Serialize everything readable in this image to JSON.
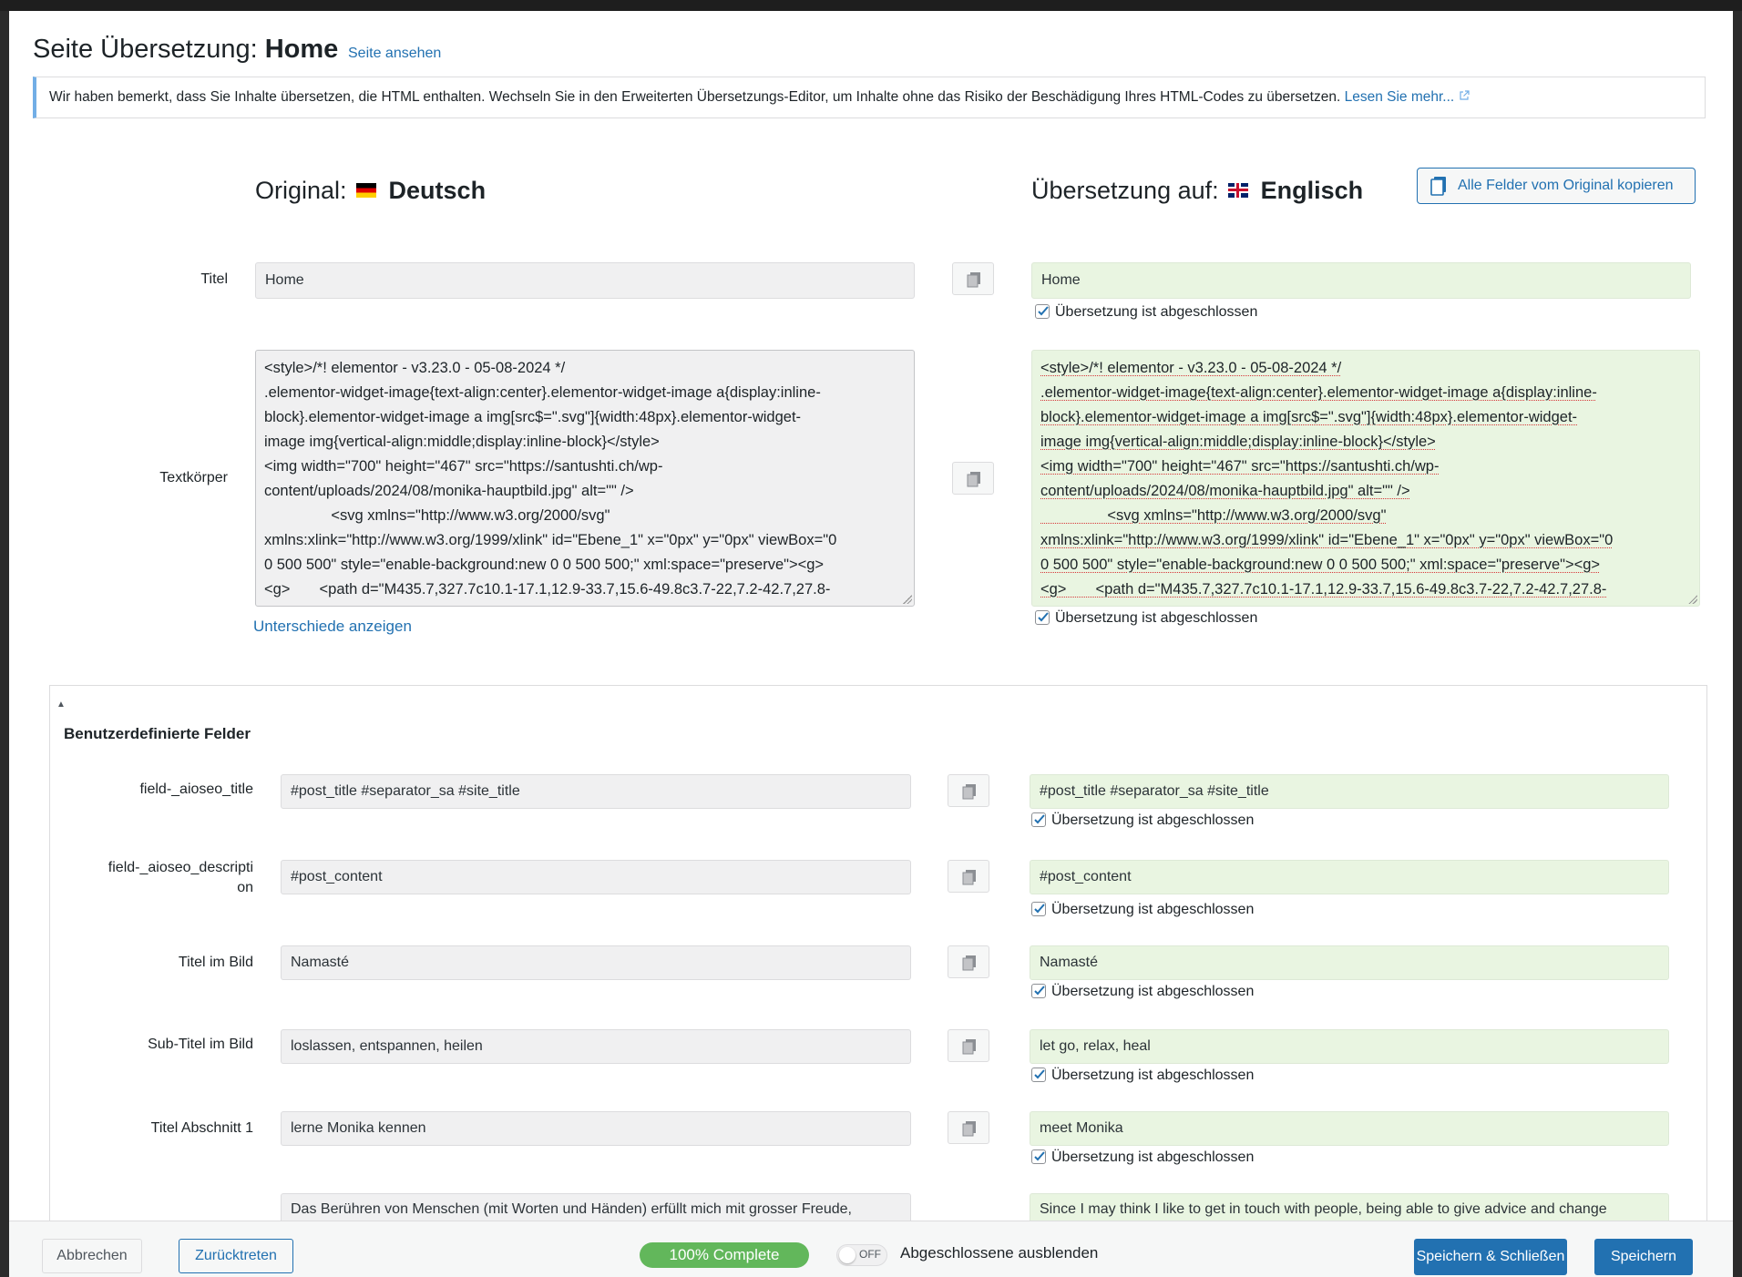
{
  "header": {
    "title_prefix": "Seite Übersetzung:",
    "title_page": "Home",
    "view_link": "Seite ansehen"
  },
  "notice": {
    "text": "Wir haben bemerkt, dass Sie Inhalte übersetzen, die HTML enthalten. Wechseln Sie in den Erweiterten Übersetzungs-Editor, um Inhalte ohne das Risiko der Beschädigung Ihres HTML-Codes zu übersetzen.",
    "link": "Lesen Sie mehr..."
  },
  "original": {
    "label": "Original:",
    "language": "Deutsch"
  },
  "translation": {
    "label": "Übersetzung auf:",
    "language": "Englisch"
  },
  "copy_all_label": "Alle Felder vom Original kopieren",
  "complete_label": "Übersetzung ist abgeschlossen",
  "title_field": {
    "label": "Titel",
    "original": "Home",
    "translation": "Home"
  },
  "body_field": {
    "label": "Textkörper",
    "original_lines": [
      "<style>/*! elementor - v3.23.0 - 05-08-2024 */",
      ".elementor-widget-image{text-align:center}.elementor-widget-image a{display:inline-",
      "block}.elementor-widget-image a img[src$=\".svg\"]{width:48px}.elementor-widget-",
      "image img{vertical-align:middle;display:inline-block}</style>",
      "<img width=\"700\" height=\"467\" src=\"https://santushti.ch/wp-",
      "content/uploads/2024/08/monika-hauptbild.jpg\" alt=\"\" />",
      "                <svg xmlns=\"http://www.w3.org/2000/svg\"",
      "xmlns:xlink=\"http://www.w3.org/1999/xlink\" id=\"Ebene_1\" x=\"0px\" y=\"0px\" viewBox=\"0",
      "0 500 500\" style=\"enable-background:new 0 0 500 500;\" xml:space=\"preserve\"><g>",
      "<g>       <path d=\"M435.7,327.7c10.1-17.1,12.9-33.7,15.6-49.8c3.7-22,7.2-42.7,27.8-"
    ],
    "translation_lines": [
      "<style>/*! elementor - v3.23.0 - 05-08-2024 */",
      ".elementor-widget-image{text-align:center}.elementor-widget-image a{display:inline-",
      "block}.elementor-widget-image a img[src$=\".svg\"]{width:48px}.elementor-widget-",
      "image img{vertical-align:middle;display:inline-block}</style>",
      "<img width=\"700\" height=\"467\" src=\"https://santushti.ch/wp-",
      "content/uploads/2024/08/monika-hauptbild.jpg\" alt=\"\" />",
      "                <svg xmlns=\"http://www.w3.org/2000/svg\"",
      "xmlns:xlink=\"http://www.w3.org/1999/xlink\" id=\"Ebene_1\" x=\"0px\" y=\"0px\" viewBox=\"0",
      "0 500 500\" style=\"enable-background:new 0 0 500 500;\" xml:space=\"preserve\"><g>",
      "<g>       <path d=\"M435.7,327.7c10.1-17.1,12.9-33.7,15.6-49.8c3.7-22,7.2-42.7,27.8-"
    ],
    "diff_link": "Unterschiede anzeigen"
  },
  "custom_fields": {
    "title": "Benutzerdefinierte Felder",
    "caret": "▲",
    "items": [
      {
        "label": "field-_aioseo_title",
        "original": "#post_title #separator_sa #site_title",
        "translation": "#post_title #separator_sa #site_title"
      },
      {
        "label_line1": "field-_aioseo_descripti",
        "label_line2": "on",
        "original": "#post_content",
        "translation": "#post_content"
      },
      {
        "label": "Titel im Bild",
        "original": "Namasté",
        "translation": "Namasté"
      },
      {
        "label": "Sub-Titel im Bild",
        "original": "loslassen, entspannen, heilen",
        "translation": "let go, relax, heal"
      },
      {
        "label": "Titel Abschnitt 1",
        "original": "lerne Monika kennen",
        "translation": "meet Monika"
      },
      {
        "original": "Das Berühren von Menschen (mit Worten und Händen) erfüllt mich mit grosser Freude,",
        "translation": "Since I may think I like to get in touch with people, being able to give advice and change"
      }
    ]
  },
  "footer": {
    "cancel": "Abbrechen",
    "back": "Zurücktreten",
    "progress": "100% Complete",
    "progress_percent": 100,
    "toggle_state": "OFF",
    "hide_completed": "Abgeschlossene ausblenden",
    "save_close": "Speichern & Schließen",
    "save": "Speichern"
  },
  "colors": {
    "accent": "#2271b1",
    "translation_bg": "#e9f5e1",
    "progress": "#62b75b",
    "notice_border": "#72aee6"
  },
  "icons": {
    "copy": "copy-icon",
    "checkbox": "checkmark-icon",
    "external": "external-link-icon",
    "document": "document-icon"
  }
}
